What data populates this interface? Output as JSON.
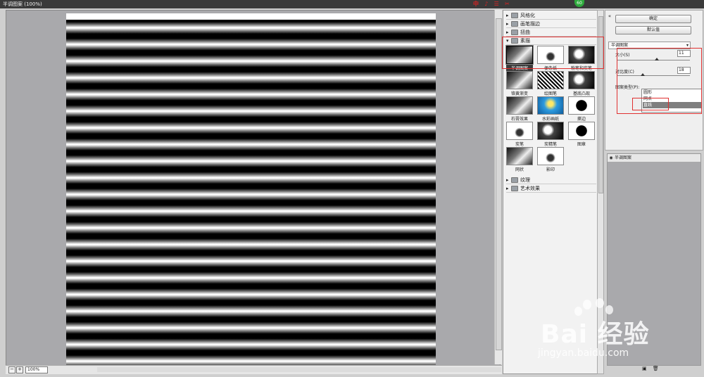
{
  "window": {
    "title": "半调图案 (100%)"
  },
  "brand_icons": [
    "中",
    "♪",
    "☰",
    "✂"
  ],
  "zoom_circle": "60",
  "preview": {
    "zoom": "100%"
  },
  "categories_top": [
    {
      "label": "风格化",
      "expanded": false
    },
    {
      "label": "画笔描边",
      "expanded": false
    },
    {
      "label": "扭曲",
      "expanded": false
    },
    {
      "label": "素描",
      "expanded": true
    }
  ],
  "sketch_filters": [
    {
      "label": "半调图案",
      "thumb": "gray",
      "selected": true
    },
    {
      "label": "便条纸",
      "thumb": "white",
      "selected": false
    },
    {
      "label": "粉笔和炭笔",
      "thumb": "dark",
      "selected": false
    },
    {
      "label": "铬黄渐变",
      "thumb": "gray",
      "selected": false
    },
    {
      "label": "绘图笔",
      "thumb": "noise",
      "selected": false
    },
    {
      "label": "基底凸现",
      "thumb": "dark",
      "selected": false
    },
    {
      "label": "石膏效果",
      "thumb": "gray",
      "selected": false
    },
    {
      "label": "水彩画纸",
      "thumb": "blue",
      "selected": false
    },
    {
      "label": "撕边",
      "thumb": "stamp",
      "selected": false
    },
    {
      "label": "炭笔",
      "thumb": "white",
      "selected": false
    },
    {
      "label": "炭精笔",
      "thumb": "dark",
      "selected": false
    },
    {
      "label": "图章",
      "thumb": "stamp",
      "selected": false
    },
    {
      "label": "网状",
      "thumb": "gray",
      "selected": false
    },
    {
      "label": "影印",
      "thumb": "white",
      "selected": false
    }
  ],
  "categories_bottom": [
    {
      "label": "纹理",
      "expanded": false
    },
    {
      "label": "艺术效果",
      "expanded": false
    }
  ],
  "controls": {
    "ok": "确定",
    "default": "默认值",
    "filter_select": "半调图案",
    "size_label": "大小(S)",
    "size_value": "11",
    "size_level": 0.55,
    "contrast_label": "对比度(C)",
    "contrast_value": "18",
    "contrast_level": 0.36,
    "pattern_label": "图案类型(P):",
    "pattern_value": "直线",
    "pattern_options": [
      "圆形",
      "网点",
      "直线"
    ],
    "pattern_highlight": 2
  },
  "layers": {
    "items": [
      "半调图案"
    ]
  },
  "watermark": {
    "brand": "Bai 经验",
    "url": "jingyan.baidu.com"
  }
}
